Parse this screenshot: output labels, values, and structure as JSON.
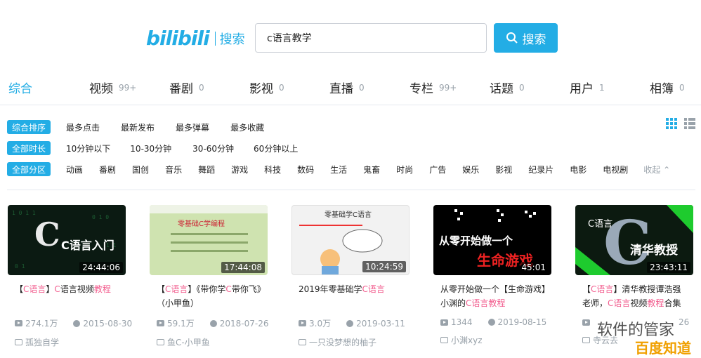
{
  "header": {
    "logo_text": "bilibili",
    "logo_sub": "搜索",
    "search_value": "c语言教学",
    "search_button": "搜索"
  },
  "tabs": [
    {
      "label": "综合",
      "count": ""
    },
    {
      "label": "视频",
      "count": "99+"
    },
    {
      "label": "番剧",
      "count": "0"
    },
    {
      "label": "影视",
      "count": "0"
    },
    {
      "label": "直播",
      "count": "0"
    },
    {
      "label": "专栏",
      "count": "99+"
    },
    {
      "label": "话题",
      "count": "0"
    },
    {
      "label": "用户",
      "count": "1"
    },
    {
      "label": "相簿",
      "count": "0"
    }
  ],
  "filters": {
    "sort": {
      "chip": "综合排序",
      "options": [
        "最多点击",
        "最新发布",
        "最多弹幕",
        "最多收藏"
      ]
    },
    "duration": {
      "chip": "全部时长",
      "options": [
        "10分钟以下",
        "10-30分钟",
        "30-60分钟",
        "60分钟以上"
      ]
    },
    "zone": {
      "chip": "全部分区",
      "options": [
        "动画",
        "番剧",
        "国创",
        "音乐",
        "舞蹈",
        "游戏",
        "科技",
        "数码",
        "生活",
        "鬼畜",
        "时尚",
        "广告",
        "娱乐",
        "影视",
        "纪录片",
        "电影",
        "电视剧"
      ],
      "collapse": "收起"
    }
  },
  "videos": [
    {
      "thumb_text": "C语言入门",
      "duration": "24:44:06",
      "title_pre": "【",
      "title_hl1": "C语言",
      "title_mid": "】",
      "title_hl2": "C",
      "title_rest": "语言视频",
      "title_hl3": "教程",
      "title_tail": "",
      "views": "274.1万",
      "date": "2015-08-30",
      "uploader": "孤独自学",
      "accent": "#0b1a12"
    },
    {
      "thumb_text": "零基础C学编程",
      "duration": "17:44:08",
      "title_pre": "【",
      "title_hl1": "C语言",
      "title_mid": "】《带你学",
      "title_hl2": "C",
      "title_rest": "带你飞》（小甲鱼）",
      "title_hl3": "",
      "title_tail": "",
      "views": "59.1万",
      "date": "2018-07-26",
      "uploader": "鱼C-小甲鱼",
      "accent": "#cfe3b0"
    },
    {
      "thumb_text": "零基础学C语言",
      "duration": "10:24:59",
      "title_pre": "2019年零基础学",
      "title_hl1": "C语言",
      "title_mid": "",
      "title_hl2": "",
      "title_rest": "",
      "title_hl3": "",
      "title_tail": "",
      "views": "3.0万",
      "date": "2019-03-11",
      "uploader": "一只没梦想的柚子",
      "accent": "#f2f2f2"
    },
    {
      "thumb_text": "从零开始做一个",
      "duration": "45:01",
      "title_pre": "从零开始做一个【生命游戏】小渊的",
      "title_hl1": "C语言",
      "title_mid": "",
      "title_hl2": "",
      "title_rest": "",
      "title_hl3": "教程",
      "title_tail": "",
      "views": "1344",
      "date": "2019-08-15",
      "uploader": "小渊xyz",
      "accent": "#000000"
    },
    {
      "thumb_text": "清华教授",
      "duration": "23:43:11",
      "title_pre": "【",
      "title_hl1": "C语言",
      "title_mid": "】清华教授谭浩强老师，",
      "title_hl2": "C语言",
      "title_rest": "视频",
      "title_hl3": "教程",
      "title_tail": "合集",
      "views": "",
      "date": "26",
      "uploader": "寺云去",
      "accent": "#1a3a1a"
    }
  ],
  "watermark": {
    "line1": "软件的管家",
    "line2": "百度知道"
  }
}
